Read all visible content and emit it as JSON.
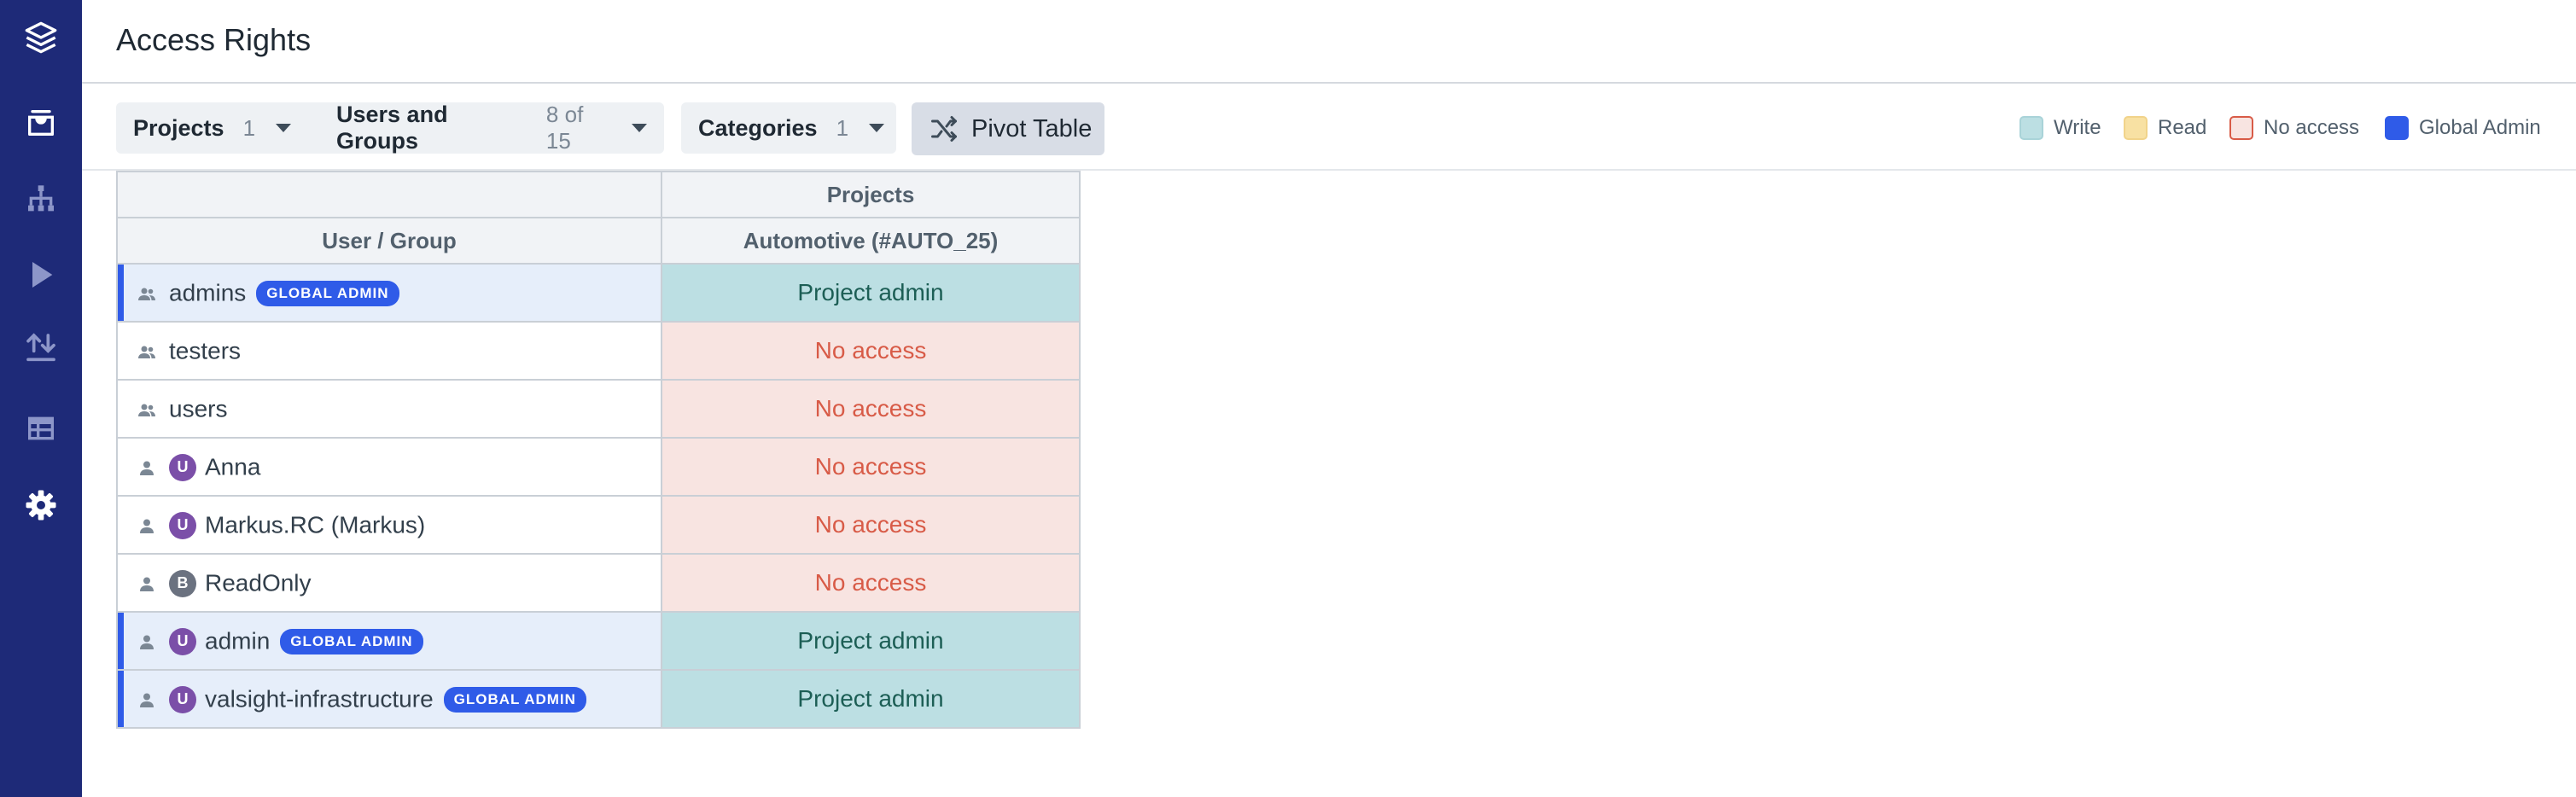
{
  "page": {
    "title": "Access Rights"
  },
  "sidebar": {
    "items": [
      {
        "icon": "layers-icon"
      },
      {
        "icon": "inbox-icon"
      },
      {
        "icon": "hierarchy-icon"
      },
      {
        "icon": "play-icon"
      },
      {
        "icon": "transfer-icon"
      },
      {
        "icon": "table-icon"
      },
      {
        "icon": "gear-icon",
        "active": true
      }
    ]
  },
  "toolbar": {
    "filters": [
      {
        "label": "Projects",
        "count": "1"
      },
      {
        "label": "Users and Groups",
        "count": "8 of 15"
      },
      {
        "label": "Categories",
        "count": "1"
      }
    ],
    "pivot_label": "Pivot Table"
  },
  "legend": [
    {
      "label": "Write",
      "color": "#bcdfe3"
    },
    {
      "label": "Read",
      "color": "#f8e1a3"
    },
    {
      "label": "No access",
      "color": "#f8e4e1"
    },
    {
      "label": "Global Admin",
      "color": "#2f5be8"
    }
  ],
  "table": {
    "group_header": "Projects",
    "col_user": "User / Group",
    "col_project": "Automotive (#AUTO_25)",
    "badge_label": "GLOBAL ADMIN",
    "rows": [
      {
        "type": "group",
        "name": "admins",
        "global_admin": true,
        "access": "Project admin",
        "level": "write"
      },
      {
        "type": "group",
        "name": "testers",
        "global_admin": false,
        "access": "No access",
        "level": "none"
      },
      {
        "type": "group",
        "name": "users",
        "global_admin": false,
        "access": "No access",
        "level": "none"
      },
      {
        "type": "user",
        "avatar": "U",
        "name": "Anna",
        "global_admin": false,
        "access": "No access",
        "level": "none"
      },
      {
        "type": "user",
        "avatar": "U",
        "name": "Markus.RC (Markus)",
        "global_admin": false,
        "access": "No access",
        "level": "none"
      },
      {
        "type": "user",
        "avatar": "B",
        "name": "ReadOnly",
        "global_admin": false,
        "access": "No access",
        "level": "none"
      },
      {
        "type": "user",
        "avatar": "U",
        "name": "admin",
        "global_admin": true,
        "access": "Project admin",
        "level": "write"
      },
      {
        "type": "user",
        "avatar": "U",
        "name": "valsight-infrastructure",
        "global_admin": true,
        "access": "Project admin",
        "level": "write"
      }
    ]
  }
}
